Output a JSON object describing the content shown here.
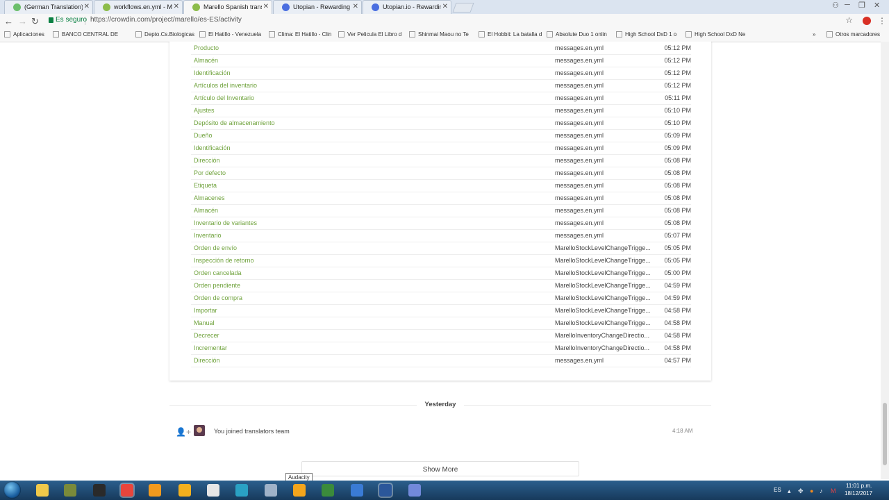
{
  "tabs": [
    {
      "title": "(German Translation) e2",
      "color": "#6cbf6c",
      "active": false
    },
    {
      "title": "workflows.en.yml - Mare",
      "color": "#8cbc4a",
      "active": false
    },
    {
      "title": "Marello Spanish translat",
      "color": "#8cbc4a",
      "active": true
    },
    {
      "title": "Utopian - Rewarding Op",
      "color": "#4a6ee0",
      "active": false
    },
    {
      "title": "Utopian.io - Rewarding C",
      "color": "#4a6ee0",
      "active": false
    }
  ],
  "toolbar": {
    "secure_label": "Es seguro",
    "url": "https://crowdin.com/project/marello/es-ES/activity"
  },
  "bookmarks": [
    {
      "label": "Aplicaciones",
      "icon": "apps-grid-icon"
    },
    {
      "label": "BANCO CENTRAL DE",
      "icon": "page-icon"
    },
    {
      "label": "Depto.Cs.Biologicas",
      "icon": "page-icon"
    },
    {
      "label": "El Hatillo - Venezuela",
      "icon": "bookmark-icon"
    },
    {
      "label": "Clima: El Hatillo - Clin",
      "icon": "chart-icon"
    },
    {
      "label": "Ver Pelicula El Libro d",
      "icon": "film-icon"
    },
    {
      "label": "Shinmai Maou no Te",
      "icon": "triangle-icon"
    },
    {
      "label": "El Hobbit: La batalla d",
      "icon": "page-icon"
    },
    {
      "label": "Absolute Duo 1 onlin",
      "icon": "triangle-icon"
    },
    {
      "label": "High School DxD 1 o",
      "icon": "triangle-icon"
    },
    {
      "label": "High School DxD Ne",
      "icon": "triangle-icon"
    },
    {
      "label": "Otros marcadores",
      "icon": "folder-icon"
    }
  ],
  "activity_rows": [
    {
      "string": "Producto",
      "file": "messages.en.yml",
      "time": "05:12 PM"
    },
    {
      "string": "Almacén",
      "file": "messages.en.yml",
      "time": "05:12 PM"
    },
    {
      "string": "Identificación",
      "file": "messages.en.yml",
      "time": "05:12 PM"
    },
    {
      "string": "Artículos del inventario",
      "file": "messages.en.yml",
      "time": "05:12 PM"
    },
    {
      "string": "Artículo del Inventario",
      "file": "messages.en.yml",
      "time": "05:11 PM"
    },
    {
      "string": "Ajustes",
      "file": "messages.en.yml",
      "time": "05:10 PM"
    },
    {
      "string": "Depósito de almacenamiento",
      "file": "messages.en.yml",
      "time": "05:10 PM"
    },
    {
      "string": "Dueño",
      "file": "messages.en.yml",
      "time": "05:09 PM"
    },
    {
      "string": "Identificación",
      "file": "messages.en.yml",
      "time": "05:09 PM"
    },
    {
      "string": "Dirección",
      "file": "messages.en.yml",
      "time": "05:08 PM"
    },
    {
      "string": "Por defecto",
      "file": "messages.en.yml",
      "time": "05:08 PM"
    },
    {
      "string": "Etiqueta",
      "file": "messages.en.yml",
      "time": "05:08 PM"
    },
    {
      "string": "Almacenes",
      "file": "messages.en.yml",
      "time": "05:08 PM"
    },
    {
      "string": "Almacén",
      "file": "messages.en.yml",
      "time": "05:08 PM"
    },
    {
      "string": "Inventario de variantes",
      "file": "messages.en.yml",
      "time": "05:08 PM"
    },
    {
      "string": "Inventario",
      "file": "messages.en.yml",
      "time": "05:07 PM"
    },
    {
      "string": "Orden de envío",
      "file": "MarelloStockLevelChangeTrigge...",
      "time": "05:05 PM"
    },
    {
      "string": "Inspección de retorno",
      "file": "MarelloStockLevelChangeTrigge...",
      "time": "05:05 PM"
    },
    {
      "string": "Orden cancelada",
      "file": "MarelloStockLevelChangeTrigge...",
      "time": "05:00 PM"
    },
    {
      "string": "Orden pendiente",
      "file": "MarelloStockLevelChangeTrigge...",
      "time": "04:59 PM"
    },
    {
      "string": "Orden de compra",
      "file": "MarelloStockLevelChangeTrigge...",
      "time": "04:59 PM"
    },
    {
      "string": "Importar",
      "file": "MarelloStockLevelChangeTrigge...",
      "time": "04:58 PM"
    },
    {
      "string": "Manual",
      "file": "MarelloStockLevelChangeTrigge...",
      "time": "04:58 PM"
    },
    {
      "string": "Decrecer",
      "file": "MarelloInventoryChangeDirectio...",
      "time": "04:58 PM"
    },
    {
      "string": "Incrementar",
      "file": "MarelloInventoryChangeDirectio...",
      "time": "04:58 PM"
    },
    {
      "string": "Dirección",
      "file": "messages.en.yml",
      "time": "04:57 PM"
    }
  ],
  "day_separator": "Yesterday",
  "team_event": {
    "text": "You joined translators team",
    "time": "4:18 AM"
  },
  "show_more_label": "Show More",
  "tooltip": "Audacity",
  "taskbar": {
    "apps": [
      {
        "name": "explorer-icon",
        "color": "#f0c94a"
      },
      {
        "name": "game-icon",
        "color": "#7a8a3a"
      },
      {
        "name": "fifa-icon",
        "color": "#2a2a2a"
      },
      {
        "name": "chrome-icon",
        "color": "#e8453c"
      },
      {
        "name": "media-player-icon",
        "color": "#f19a1e"
      },
      {
        "name": "apps-grid-icon",
        "color": "#f2b01e"
      },
      {
        "name": "skull-icon",
        "color": "#e6e6e6"
      },
      {
        "name": "globe-icon",
        "color": "#2aa1c4"
      },
      {
        "name": "keyboard-icon",
        "color": "#9fb2c8"
      },
      {
        "name": "audacity-icon",
        "color": "#f4a51c"
      },
      {
        "name": "tree-icon",
        "color": "#3b8b3b"
      },
      {
        "name": "scribe-icon",
        "color": "#3a7bd5"
      },
      {
        "name": "word-icon",
        "color": "#2b579a"
      },
      {
        "name": "discord-icon",
        "color": "#7289da"
      }
    ],
    "language": "ES",
    "clock_time": "11:01 p.m.",
    "clock_date": "18/12/2017"
  },
  "colors": {
    "string_link": "#6fa23c",
    "taskbar": "#1f4a74"
  }
}
